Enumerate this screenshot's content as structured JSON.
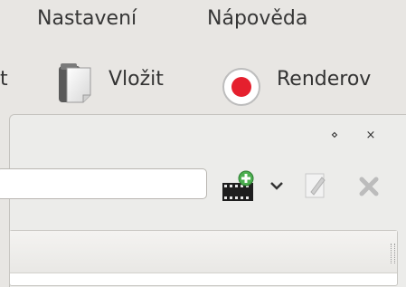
{
  "menubar": {
    "settings": "Nastavení",
    "help": "Nápověda"
  },
  "toolbar": {
    "prev_label_fragment": "t",
    "paste_label": "Vložit",
    "render_label": "Renderov"
  },
  "panel": {
    "float_glyph": "⋄",
    "close_glyph": "×",
    "search_value": "",
    "search_placeholder": ""
  },
  "icons": {
    "paste": "clipboard-icon",
    "render": "record-icon",
    "add_clip": "add-clip-icon",
    "dropdown": "chevron-down-icon",
    "edit": "edit-icon",
    "delete": "delete-icon"
  },
  "colors": {
    "record_red": "#e5202e",
    "add_green": "#4caf50"
  }
}
